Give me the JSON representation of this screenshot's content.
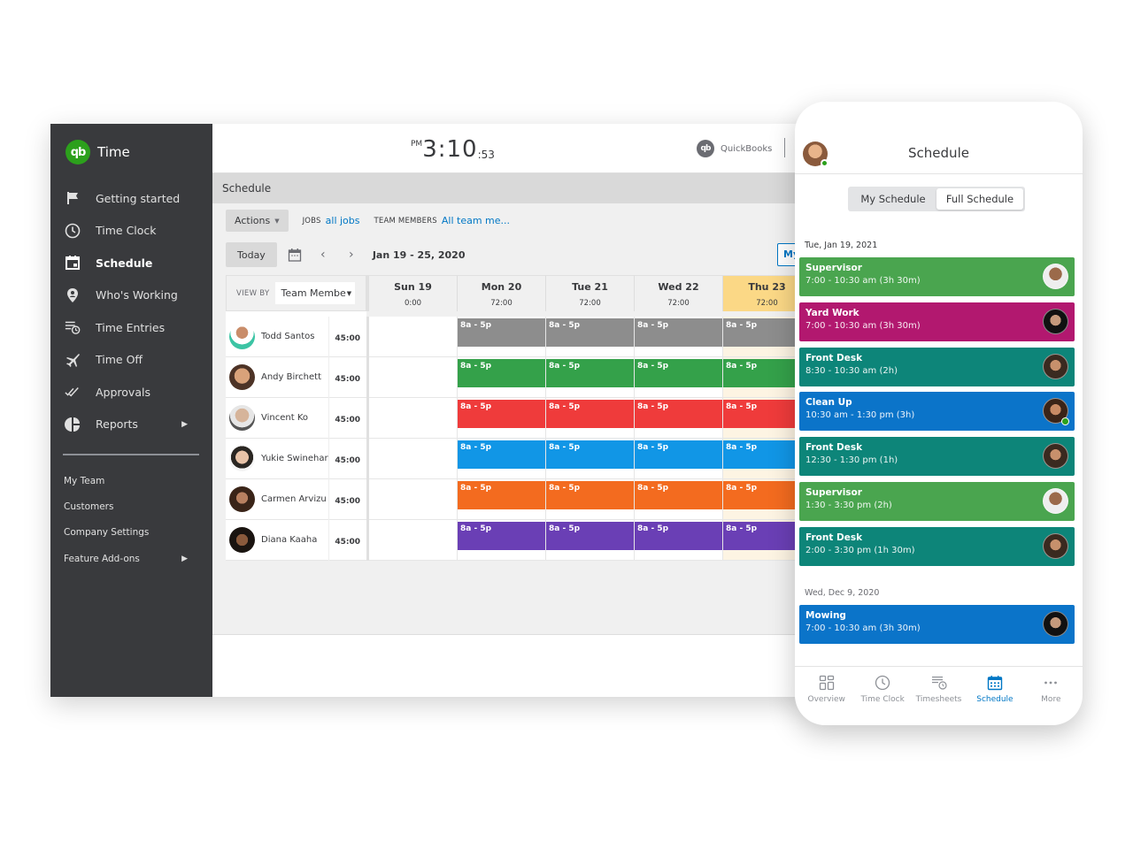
{
  "app": {
    "logo_text": "qb",
    "title": "Time"
  },
  "sidebar": {
    "items": [
      {
        "label": "Getting started",
        "icon": "flag-icon"
      },
      {
        "label": "Time Clock",
        "icon": "clock-icon"
      },
      {
        "label": "Schedule",
        "icon": "calendar-icon",
        "active": true
      },
      {
        "label": "Who's Working",
        "icon": "location-pin-icon"
      },
      {
        "label": "Time Entries",
        "icon": "time-entries-icon"
      },
      {
        "label": "Time Off",
        "icon": "airplane-icon"
      },
      {
        "label": "Approvals",
        "icon": "double-check-icon"
      },
      {
        "label": "Reports",
        "icon": "pie-chart-icon",
        "has_submenu": true
      }
    ],
    "secondary": [
      {
        "label": "My Team"
      },
      {
        "label": "Customers"
      },
      {
        "label": "Company Settings"
      },
      {
        "label": "Feature Add-ons",
        "has_submenu": true
      }
    ]
  },
  "topbar": {
    "clock": {
      "ampm": "PM",
      "hours_minutes": "3:10",
      "seconds": ":53"
    },
    "quickbooks_label": "QuickBooks",
    "quickbooks_logo": "qb"
  },
  "schedule": {
    "title": "Schedule",
    "actions_label": "Actions",
    "jobs_label": "JOBS",
    "jobs_value": "all jobs",
    "members_label": "TEAM MEMBERS",
    "members_value": "All team me...",
    "today_label": "Today",
    "prev_label": "‹",
    "next_label": "›",
    "date_range": "Jan 19 - 25, 2020",
    "my_button": "My",
    "view_by_label": "VIEW BY",
    "view_by_value": "Team Membe",
    "days": [
      {
        "name": "Sun 19",
        "total": "0:00",
        "today": false
      },
      {
        "name": "Mon 20",
        "total": "72:00",
        "today": false
      },
      {
        "name": "Tue 21",
        "total": "72:00",
        "today": false
      },
      {
        "name": "Wed 22",
        "total": "72:00",
        "today": false
      },
      {
        "name": "Thu 23",
        "total": "72:00",
        "today": true
      }
    ],
    "members": [
      {
        "name": "Todd Santos",
        "hours": "45:00",
        "color": "#8d8d8d",
        "shift": "8a - 5p"
      },
      {
        "name": "Andy Birchett",
        "hours": "45:00",
        "color": "#34a14a",
        "shift": "8a - 5p"
      },
      {
        "name": "Vincent Ko",
        "hours": "45:00",
        "color": "#ef3b3b",
        "shift": "8a - 5p"
      },
      {
        "name": "Yukie Swinehart",
        "hours": "45:00",
        "color": "#1196e6",
        "shift": "8a - 5p"
      },
      {
        "name": "Carmen Arvizu",
        "hours": "45:00",
        "color": "#f36b1f",
        "shift": "8a - 5p"
      },
      {
        "name": "Diana Kaaha",
        "hours": "45:00",
        "color": "#6a3fb5",
        "shift": "8a - 5p"
      }
    ]
  },
  "mobile": {
    "title": "Schedule",
    "tabs": [
      {
        "label": "My Schedule",
        "active": false
      },
      {
        "label": "Full Schedule",
        "active": true
      }
    ],
    "groups": [
      {
        "date": "Tue, Jan 19, 2021",
        "shifts": [
          {
            "title": "Supervisor",
            "time": "7:00 - 10:30 am (3h 30m)",
            "color": "#4aa54f"
          },
          {
            "title": "Yard Work",
            "time": "7:00 - 10:30 am (3h 30m)",
            "color": "#b2186f"
          },
          {
            "title": "Front Desk",
            "time": "8:30 - 10:30 am (2h)",
            "color": "#0d8579"
          },
          {
            "title": "Clean Up",
            "time": "10:30 am - 1:30 pm (3h)",
            "color": "#0b74c9",
            "online": true
          },
          {
            "title": "Front Desk",
            "time": "12:30 - 1:30 pm (1h)",
            "color": "#0d8579"
          },
          {
            "title": "Supervisor",
            "time": "1:30 - 3:30 pm (2h)",
            "color": "#4aa54f"
          },
          {
            "title": "Front Desk",
            "time": "2:00 - 3:30 pm (1h 30m)",
            "color": "#0d8579"
          }
        ]
      },
      {
        "date": "Wed, Dec 9, 2020",
        "shifts": [
          {
            "title": "Mowing",
            "time": "7:00 - 10:30 am (3h 30m)",
            "color": "#0b74c9"
          }
        ]
      }
    ],
    "tabbar": [
      {
        "label": "Overview",
        "icon": "overview-icon"
      },
      {
        "label": "Time Clock",
        "icon": "clock-icon"
      },
      {
        "label": "Timesheets",
        "icon": "timesheets-icon"
      },
      {
        "label": "Schedule",
        "icon": "calendar-icon",
        "active": true
      },
      {
        "label": "More",
        "icon": "more-icon"
      }
    ]
  },
  "colors": {
    "brand_green": "#2ca01c",
    "sidebar_bg": "#393a3d",
    "link_blue": "#0077c5",
    "today_header": "#fbd886"
  }
}
